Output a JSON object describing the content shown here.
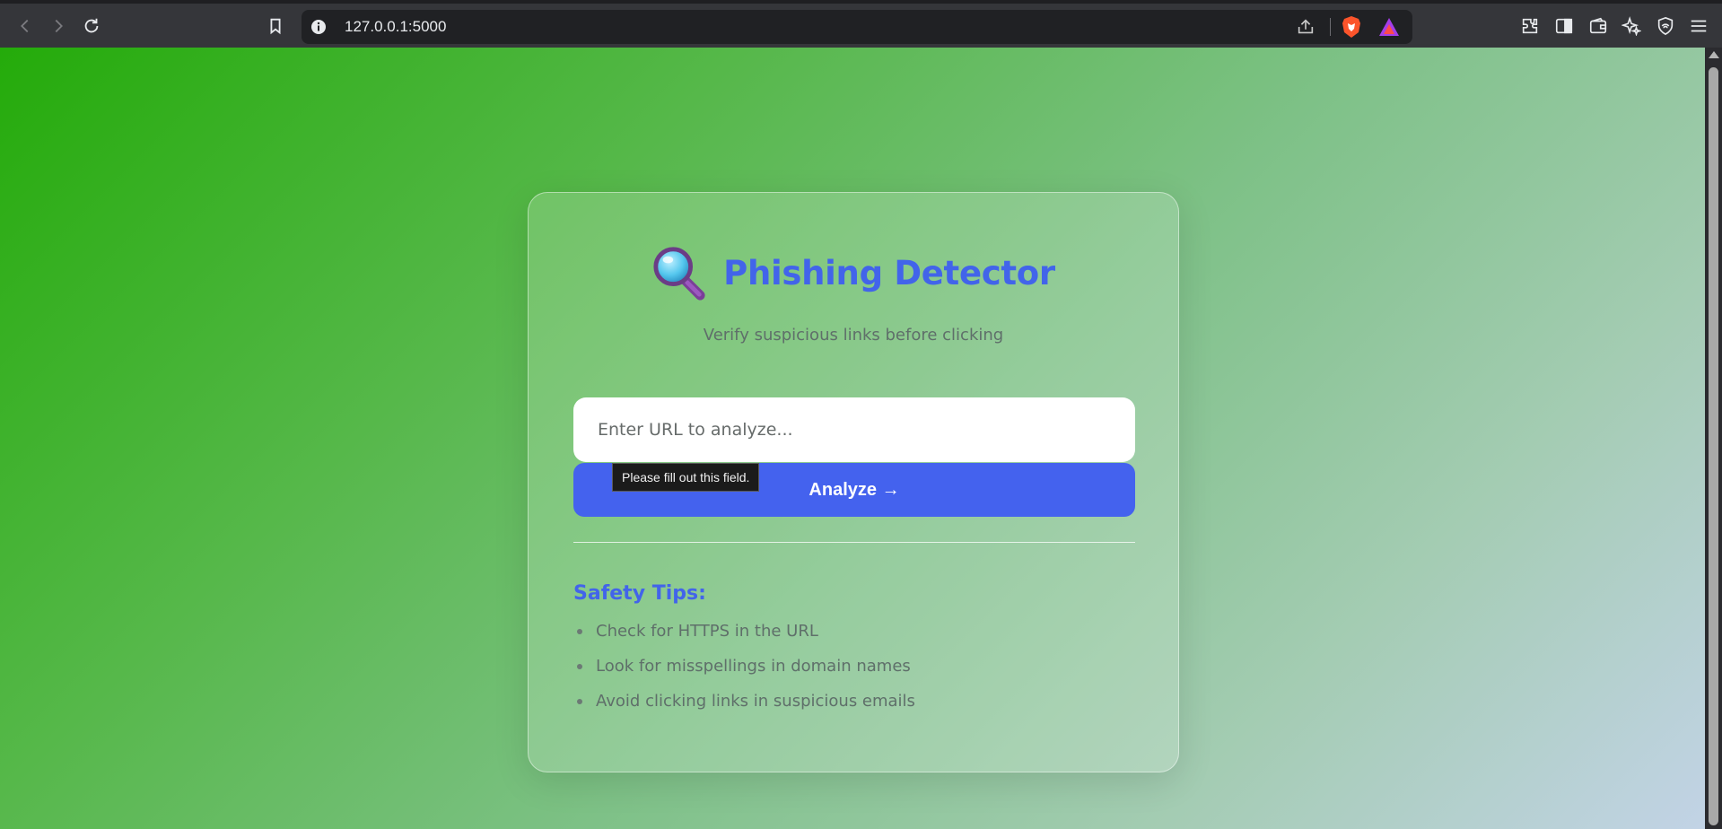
{
  "browser": {
    "url": "127.0.0.1:5000",
    "icons": [
      "back-icon",
      "forward-icon",
      "reload-icon",
      "bookmark-icon",
      "site-info-icon",
      "share-icon",
      "brave-shields-icon",
      "brave-rewards-icon",
      "extensions-icon",
      "sidebar-icon",
      "wallet-icon",
      "leo-ai-icon",
      "vpn-icon",
      "menu-icon"
    ]
  },
  "card": {
    "icon": "magnifying-glass-icon",
    "title": "Phishing Detector",
    "subtitle": "Verify suspicious links before clicking",
    "input_placeholder": "Enter URL to analyze...",
    "analyze_label": "Analyze →",
    "validation_tooltip": "Please fill out this field.",
    "tips_heading": "Safety Tips:",
    "tips": [
      "Check for HTTPS in the URL",
      "Look for misspellings in domain names",
      "Avoid clicking links in suspicious emails"
    ]
  },
  "colors": {
    "accent": "#4462ee",
    "title": "#4264ea",
    "muted_text": "#5f6f6a",
    "gradient_start": "#24ab0a",
    "gradient_end": "#c2d3e6"
  }
}
